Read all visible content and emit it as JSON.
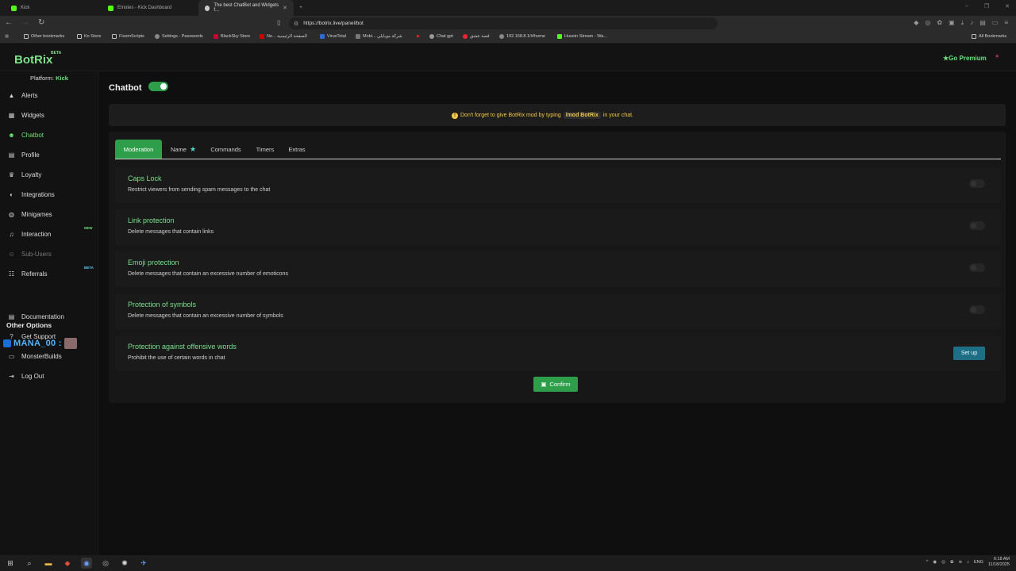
{
  "browser": {
    "tabs": [
      {
        "title": "Kick",
        "color": "#53fc18"
      },
      {
        "title": "Emotes - Kick Dashboard",
        "color": "#53fc18"
      },
      {
        "title": "The best ChatBot and Widgets f...",
        "color": "#cccccc"
      }
    ],
    "url": "https://botrix.live/panel/bot",
    "bookmarks": [
      "Other bookmarks",
      "Ko Store",
      "FivemScripts",
      "Settings - Passwords",
      "BlackSky Store",
      "Ne... الصفحة الرئيسية",
      "VirusTotal",
      "Mobi... شركة موبايلي",
      "Chat gpt",
      "قصة عشق",
      "192.168.8.1/#/home",
      "Husein Stream - Wa..."
    ],
    "all_bookmarks": "All Bookmarks"
  },
  "header": {
    "logo": "BotRix",
    "beta": "BETA",
    "premium": "Go Premium"
  },
  "sidebar": {
    "platform_label": "Platform:",
    "platform_value": "Kick",
    "items": [
      {
        "label": "Alerts",
        "icon": "bell-icon"
      },
      {
        "label": "Widgets",
        "icon": "grid-icon"
      },
      {
        "label": "Chatbot",
        "icon": "robot-icon"
      },
      {
        "label": "Profile",
        "icon": "profile-icon"
      },
      {
        "label": "Loyalty",
        "icon": "trophy-icon"
      },
      {
        "label": "Integrations",
        "icon": "plug-icon"
      },
      {
        "label": "Minigames",
        "icon": "gamepad-icon"
      },
      {
        "label": "Interaction",
        "icon": "music-icon",
        "tag": "NEW"
      },
      {
        "label": "Sub-Users",
        "icon": "users-icon"
      },
      {
        "label": "Referrals",
        "icon": "people-icon",
        "tag": "BETA"
      }
    ],
    "other_heading": "Other Options",
    "other_items": [
      {
        "label": "Documentation",
        "icon": "book-icon"
      },
      {
        "label": "Get Support",
        "icon": "question-icon"
      },
      {
        "label": "MonsterBuilds",
        "icon": "laptop-icon"
      },
      {
        "label": "Log Out",
        "icon": "logout-icon"
      }
    ],
    "overlay_username": "MANA_00 :"
  },
  "main": {
    "title": "Chatbot",
    "chatbot_enabled": true,
    "notice_before": "Don't forget to give BotRix mod by typing",
    "notice_command": "/mod BotRix",
    "notice_after": "in your chat.",
    "tabs": [
      "Moderation",
      "Name",
      "Commands",
      "Timers",
      "Extras"
    ],
    "active_tab": "Moderation",
    "options": [
      {
        "title": "Caps Lock",
        "desc": "Restrict viewers from sending spam messages to the chat",
        "enabled": false
      },
      {
        "title": "Link protection",
        "desc": "Delete messages that contain links",
        "enabled": false
      },
      {
        "title": "Emoji protection",
        "desc": "Delete messages that contain an excessive number of emoticons",
        "enabled": false
      },
      {
        "title": "Protection of symbols",
        "desc": "Delete messages that contain an excessive number of symbols",
        "enabled": false
      },
      {
        "title": "Protection against offensive words",
        "desc": "Prohibit the use of certain words in chat",
        "action": "Set up"
      }
    ],
    "confirm": "Confirm"
  },
  "taskbar": {
    "time": "6:18 AM",
    "date": "11/18/2025",
    "lang": "ENG"
  },
  "colors": {
    "accent": "#2f9e4a",
    "accent_text": "#76e08a",
    "warning": "#f3c84b",
    "setup_button": "#1e6f86"
  }
}
